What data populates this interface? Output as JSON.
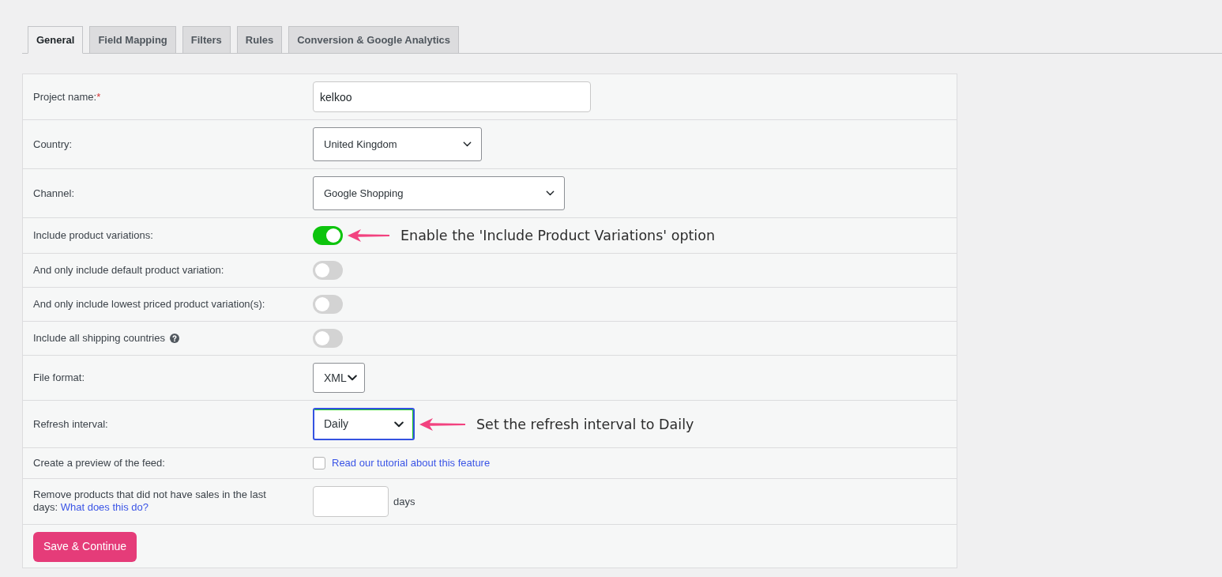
{
  "tabs": [
    {
      "label": "General",
      "selected": true
    },
    {
      "label": "Field Mapping",
      "selected": false
    },
    {
      "label": "Filters",
      "selected": false
    },
    {
      "label": "Rules",
      "selected": false
    },
    {
      "label": "Conversion & Google Analytics",
      "selected": false
    }
  ],
  "form": {
    "rows": [
      {
        "kind": "text",
        "label": "Project name:",
        "required_mark": "*",
        "value": "kelkoo"
      },
      {
        "kind": "select",
        "label": "Country:",
        "value": "United Kingdom",
        "focused": false
      },
      {
        "kind": "select",
        "label": "Channel:",
        "value": "Google Shopping",
        "focused": false
      },
      {
        "kind": "toggle",
        "label": "Include product variations:",
        "on": true,
        "annotation": "Enable the 'Include Product Variations' option"
      },
      {
        "kind": "toggle",
        "label": "And only include default product variation:",
        "on": false
      },
      {
        "kind": "toggle",
        "label": "And only include lowest priced product variation(s):",
        "on": false
      },
      {
        "kind": "toggle",
        "label": "Include all shipping countries",
        "help_icon": true,
        "on": false
      },
      {
        "kind": "select",
        "label": "File format:",
        "value": "XML",
        "focused": false
      },
      {
        "kind": "select",
        "label": "Refresh interval:",
        "value": "Daily",
        "focused": true,
        "annotation": "Set the refresh interval to Daily"
      },
      {
        "kind": "checkbox",
        "label": "Create a preview of the feed:",
        "checked": false,
        "link": "Read our tutorial about this feature"
      },
      {
        "kind": "number",
        "label": "Remove products that did not have sales in the last days:",
        "label_link": "What does this do?",
        "suffix": "days"
      }
    ],
    "save_button": "Save & Continue"
  }
}
